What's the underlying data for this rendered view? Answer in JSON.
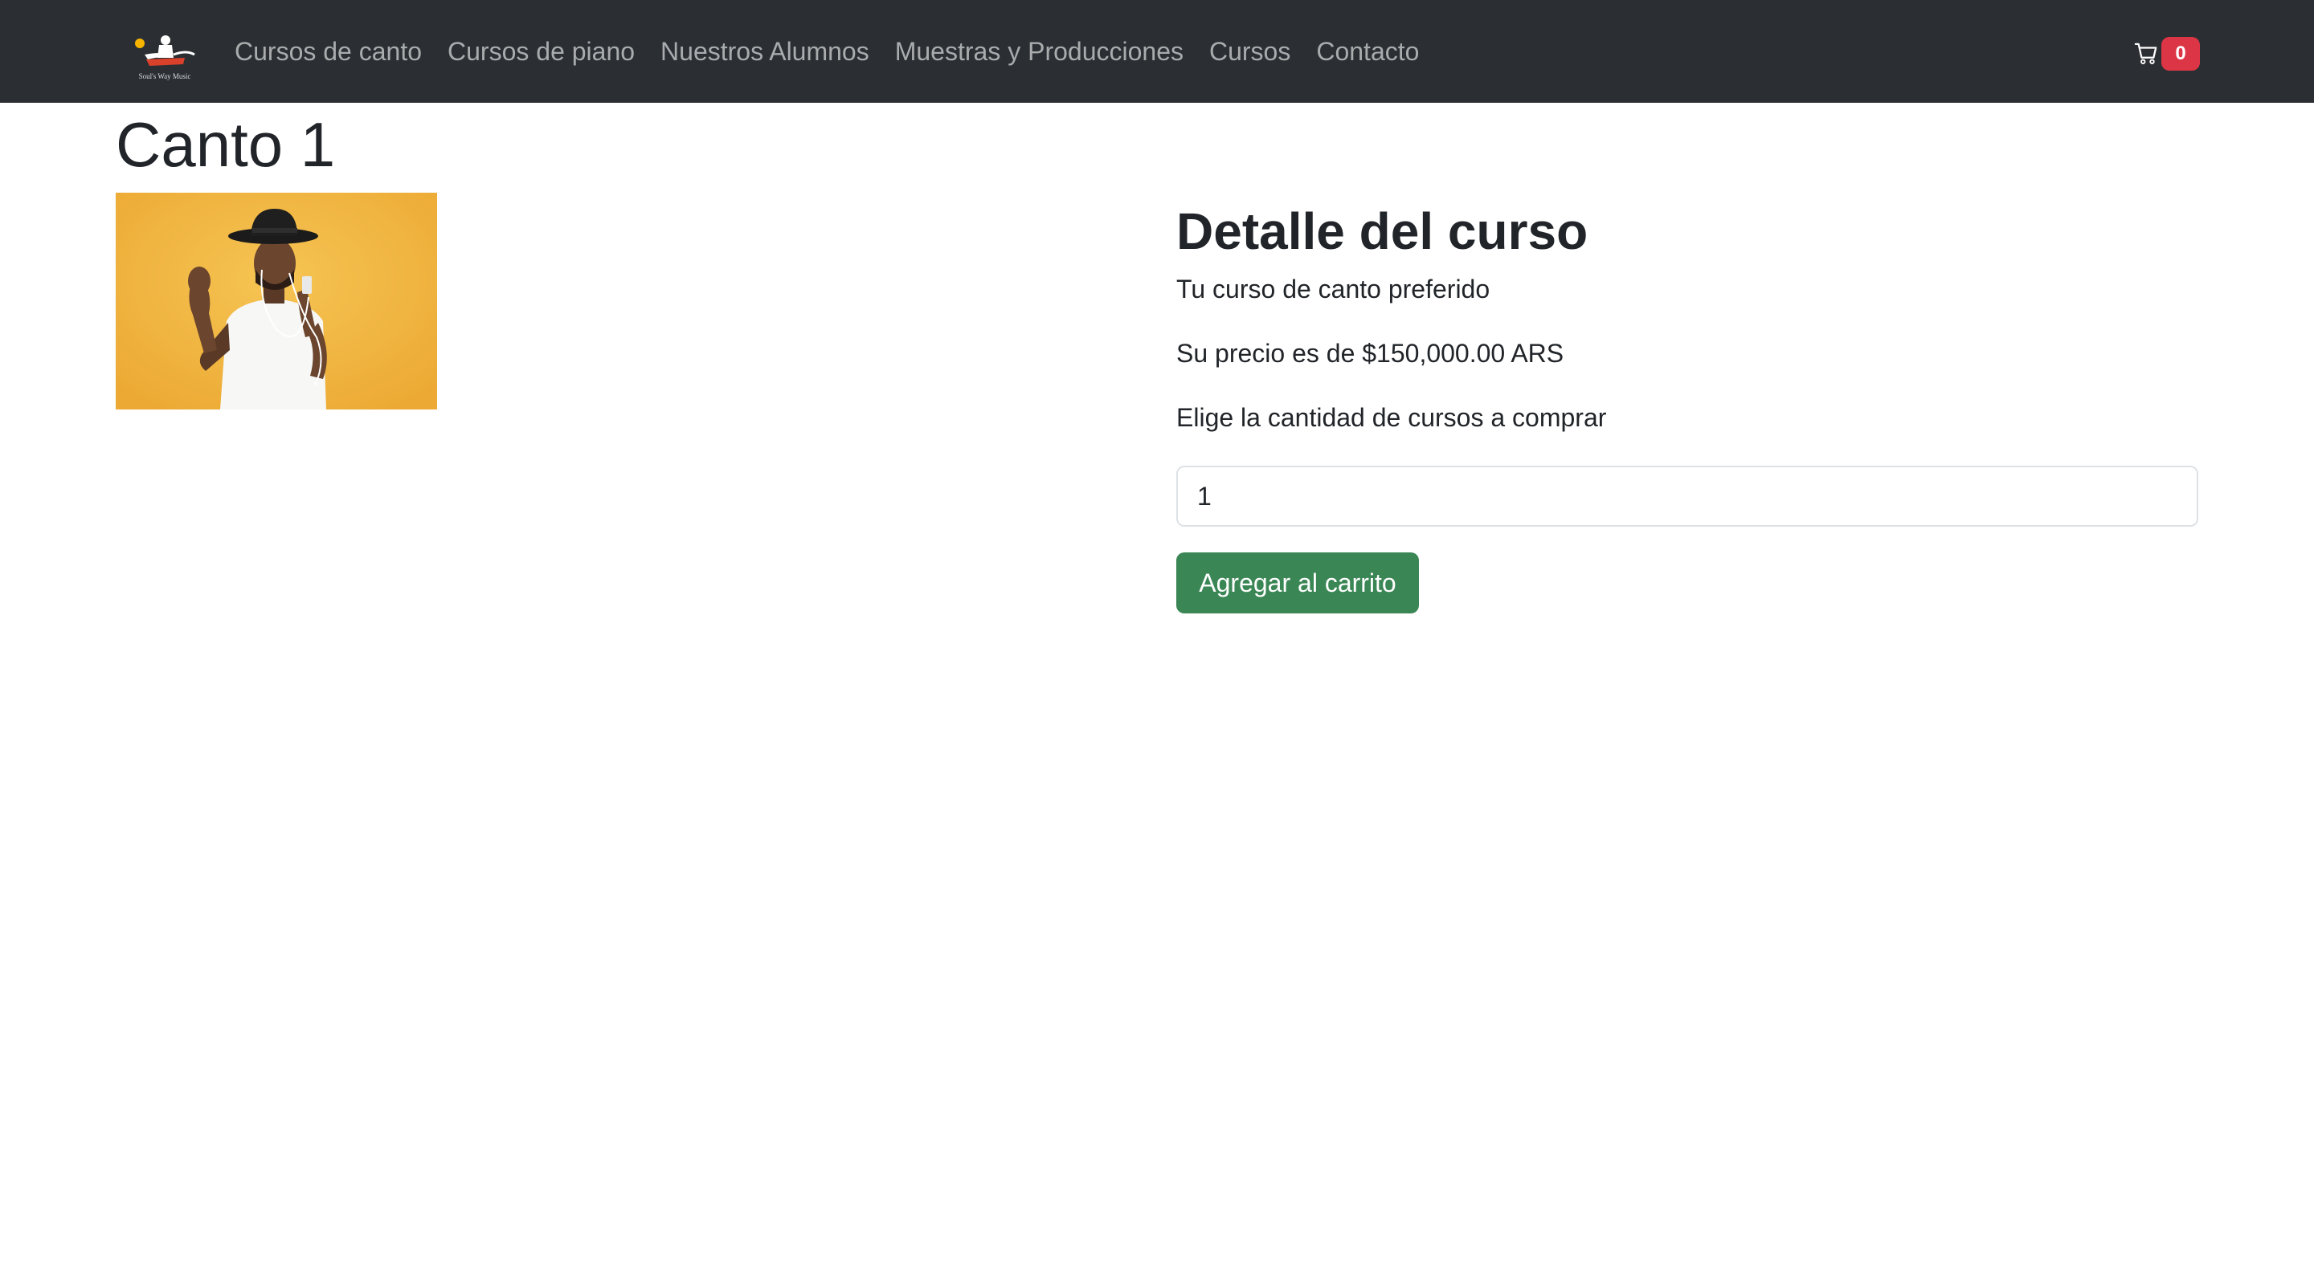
{
  "navbar": {
    "logo_text": "Soul's Way Music",
    "links": [
      {
        "label": "Cursos de canto"
      },
      {
        "label": "Cursos de piano"
      },
      {
        "label": "Nuestros Alumnos"
      },
      {
        "label": "Muestras y Producciones"
      },
      {
        "label": "Cursos"
      },
      {
        "label": "Contacto"
      }
    ],
    "cart": {
      "icon": "cart-icon",
      "count": "0"
    }
  },
  "product": {
    "title": "Canto 1",
    "image_alt": "Hombre con sombrero cantando con auriculares sobre fondo amarillo"
  },
  "detail": {
    "heading": "Detalle del curso",
    "description": "Tu curso de canto preferido",
    "price_text": "Su precio es de $150,000.00 ARS",
    "quantity_label": "Elige la cantidad de cursos a comprar",
    "quantity_value": "1",
    "add_button_label": "Agregar al carrito"
  },
  "colors": {
    "navbar_bg": "#2b2f33",
    "nav_link": "#a9abad",
    "badge": "#dc3545",
    "button": "#3a8655",
    "image_bg": "#f0b23c"
  }
}
